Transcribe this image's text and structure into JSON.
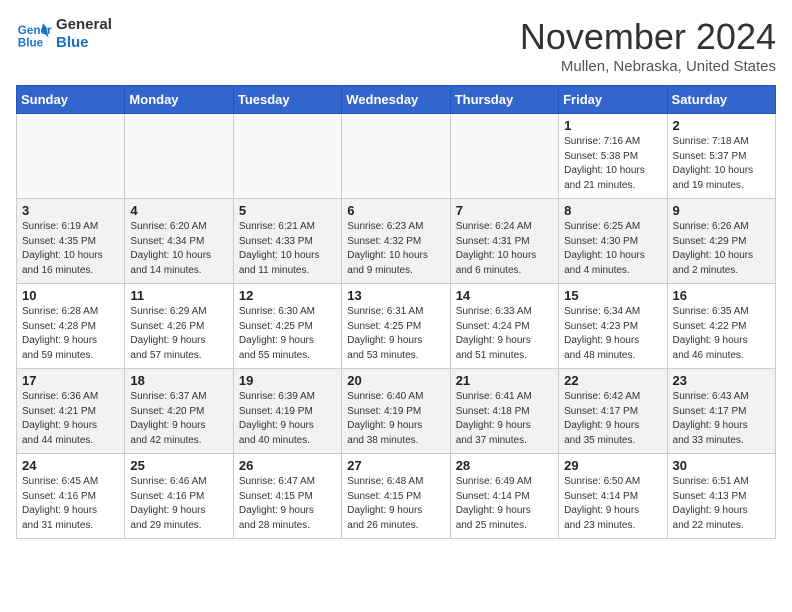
{
  "logo": {
    "line1": "General",
    "line2": "Blue"
  },
  "title": "November 2024",
  "location": "Mullen, Nebraska, United States",
  "days_of_week": [
    "Sunday",
    "Monday",
    "Tuesday",
    "Wednesday",
    "Thursday",
    "Friday",
    "Saturday"
  ],
  "weeks": [
    [
      {
        "day": "",
        "info": ""
      },
      {
        "day": "",
        "info": ""
      },
      {
        "day": "",
        "info": ""
      },
      {
        "day": "",
        "info": ""
      },
      {
        "day": "",
        "info": ""
      },
      {
        "day": "1",
        "info": "Sunrise: 7:16 AM\nSunset: 5:38 PM\nDaylight: 10 hours\nand 21 minutes."
      },
      {
        "day": "2",
        "info": "Sunrise: 7:18 AM\nSunset: 5:37 PM\nDaylight: 10 hours\nand 19 minutes."
      }
    ],
    [
      {
        "day": "3",
        "info": "Sunrise: 6:19 AM\nSunset: 4:35 PM\nDaylight: 10 hours\nand 16 minutes."
      },
      {
        "day": "4",
        "info": "Sunrise: 6:20 AM\nSunset: 4:34 PM\nDaylight: 10 hours\nand 14 minutes."
      },
      {
        "day": "5",
        "info": "Sunrise: 6:21 AM\nSunset: 4:33 PM\nDaylight: 10 hours\nand 11 minutes."
      },
      {
        "day": "6",
        "info": "Sunrise: 6:23 AM\nSunset: 4:32 PM\nDaylight: 10 hours\nand 9 minutes."
      },
      {
        "day": "7",
        "info": "Sunrise: 6:24 AM\nSunset: 4:31 PM\nDaylight: 10 hours\nand 6 minutes."
      },
      {
        "day": "8",
        "info": "Sunrise: 6:25 AM\nSunset: 4:30 PM\nDaylight: 10 hours\nand 4 minutes."
      },
      {
        "day": "9",
        "info": "Sunrise: 6:26 AM\nSunset: 4:29 PM\nDaylight: 10 hours\nand 2 minutes."
      }
    ],
    [
      {
        "day": "10",
        "info": "Sunrise: 6:28 AM\nSunset: 4:28 PM\nDaylight: 9 hours\nand 59 minutes."
      },
      {
        "day": "11",
        "info": "Sunrise: 6:29 AM\nSunset: 4:26 PM\nDaylight: 9 hours\nand 57 minutes."
      },
      {
        "day": "12",
        "info": "Sunrise: 6:30 AM\nSunset: 4:25 PM\nDaylight: 9 hours\nand 55 minutes."
      },
      {
        "day": "13",
        "info": "Sunrise: 6:31 AM\nSunset: 4:25 PM\nDaylight: 9 hours\nand 53 minutes."
      },
      {
        "day": "14",
        "info": "Sunrise: 6:33 AM\nSunset: 4:24 PM\nDaylight: 9 hours\nand 51 minutes."
      },
      {
        "day": "15",
        "info": "Sunrise: 6:34 AM\nSunset: 4:23 PM\nDaylight: 9 hours\nand 48 minutes."
      },
      {
        "day": "16",
        "info": "Sunrise: 6:35 AM\nSunset: 4:22 PM\nDaylight: 9 hours\nand 46 minutes."
      }
    ],
    [
      {
        "day": "17",
        "info": "Sunrise: 6:36 AM\nSunset: 4:21 PM\nDaylight: 9 hours\nand 44 minutes."
      },
      {
        "day": "18",
        "info": "Sunrise: 6:37 AM\nSunset: 4:20 PM\nDaylight: 9 hours\nand 42 minutes."
      },
      {
        "day": "19",
        "info": "Sunrise: 6:39 AM\nSunset: 4:19 PM\nDaylight: 9 hours\nand 40 minutes."
      },
      {
        "day": "20",
        "info": "Sunrise: 6:40 AM\nSunset: 4:19 PM\nDaylight: 9 hours\nand 38 minutes."
      },
      {
        "day": "21",
        "info": "Sunrise: 6:41 AM\nSunset: 4:18 PM\nDaylight: 9 hours\nand 37 minutes."
      },
      {
        "day": "22",
        "info": "Sunrise: 6:42 AM\nSunset: 4:17 PM\nDaylight: 9 hours\nand 35 minutes."
      },
      {
        "day": "23",
        "info": "Sunrise: 6:43 AM\nSunset: 4:17 PM\nDaylight: 9 hours\nand 33 minutes."
      }
    ],
    [
      {
        "day": "24",
        "info": "Sunrise: 6:45 AM\nSunset: 4:16 PM\nDaylight: 9 hours\nand 31 minutes."
      },
      {
        "day": "25",
        "info": "Sunrise: 6:46 AM\nSunset: 4:16 PM\nDaylight: 9 hours\nand 29 minutes."
      },
      {
        "day": "26",
        "info": "Sunrise: 6:47 AM\nSunset: 4:15 PM\nDaylight: 9 hours\nand 28 minutes."
      },
      {
        "day": "27",
        "info": "Sunrise: 6:48 AM\nSunset: 4:15 PM\nDaylight: 9 hours\nand 26 minutes."
      },
      {
        "day": "28",
        "info": "Sunrise: 6:49 AM\nSunset: 4:14 PM\nDaylight: 9 hours\nand 25 minutes."
      },
      {
        "day": "29",
        "info": "Sunrise: 6:50 AM\nSunset: 4:14 PM\nDaylight: 9 hours\nand 23 minutes."
      },
      {
        "day": "30",
        "info": "Sunrise: 6:51 AM\nSunset: 4:13 PM\nDaylight: 9 hours\nand 22 minutes."
      }
    ]
  ]
}
